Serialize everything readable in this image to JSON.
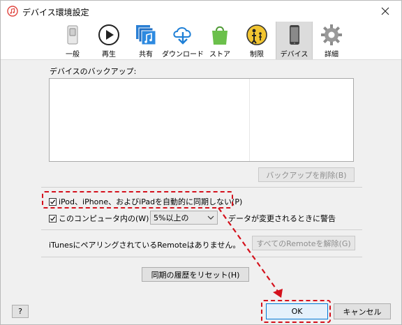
{
  "window": {
    "title": "デバイス環境設定"
  },
  "toolbar": {
    "items": [
      {
        "label": "一般",
        "icon": "switch-icon"
      },
      {
        "label": "再生",
        "icon": "play-icon"
      },
      {
        "label": "共有",
        "icon": "shared-music-icon"
      },
      {
        "label": "ダウンロード",
        "icon": "download-cloud-icon"
      },
      {
        "label": "ストア",
        "icon": "store-bag-icon"
      },
      {
        "label": "制限",
        "icon": "parental-icon"
      },
      {
        "label": "デバイス",
        "icon": "device-phone-icon"
      },
      {
        "label": "詳細",
        "icon": "gear-icon"
      }
    ],
    "active_index": 6
  },
  "backups": {
    "label": "デバイスのバックアップ:",
    "delete_button": "バックアップを削除(B)"
  },
  "options": {
    "prevent_sync": {
      "label": "iPod、iPhone、およびiPadを自動的に同期しない(P)",
      "checked": true
    },
    "warn_data": {
      "label": "このコンピュータ内の(W)",
      "checked": true
    },
    "percent_select": "5%以上の",
    "warn_suffix": "データが変更されるときに警告"
  },
  "remote": {
    "status": "iTunesにペアリングされているRemoteはありません。",
    "remove_button": "すべてのRemoteを解除(G)"
  },
  "reset_history_button": "同期の履歴をリセット(H)",
  "footer": {
    "help_button": "?",
    "ok_button": "OK",
    "cancel_button": "キャンセル"
  },
  "colors": {
    "highlight": "#d4111c",
    "accent_blue": "#1e7fd6"
  }
}
